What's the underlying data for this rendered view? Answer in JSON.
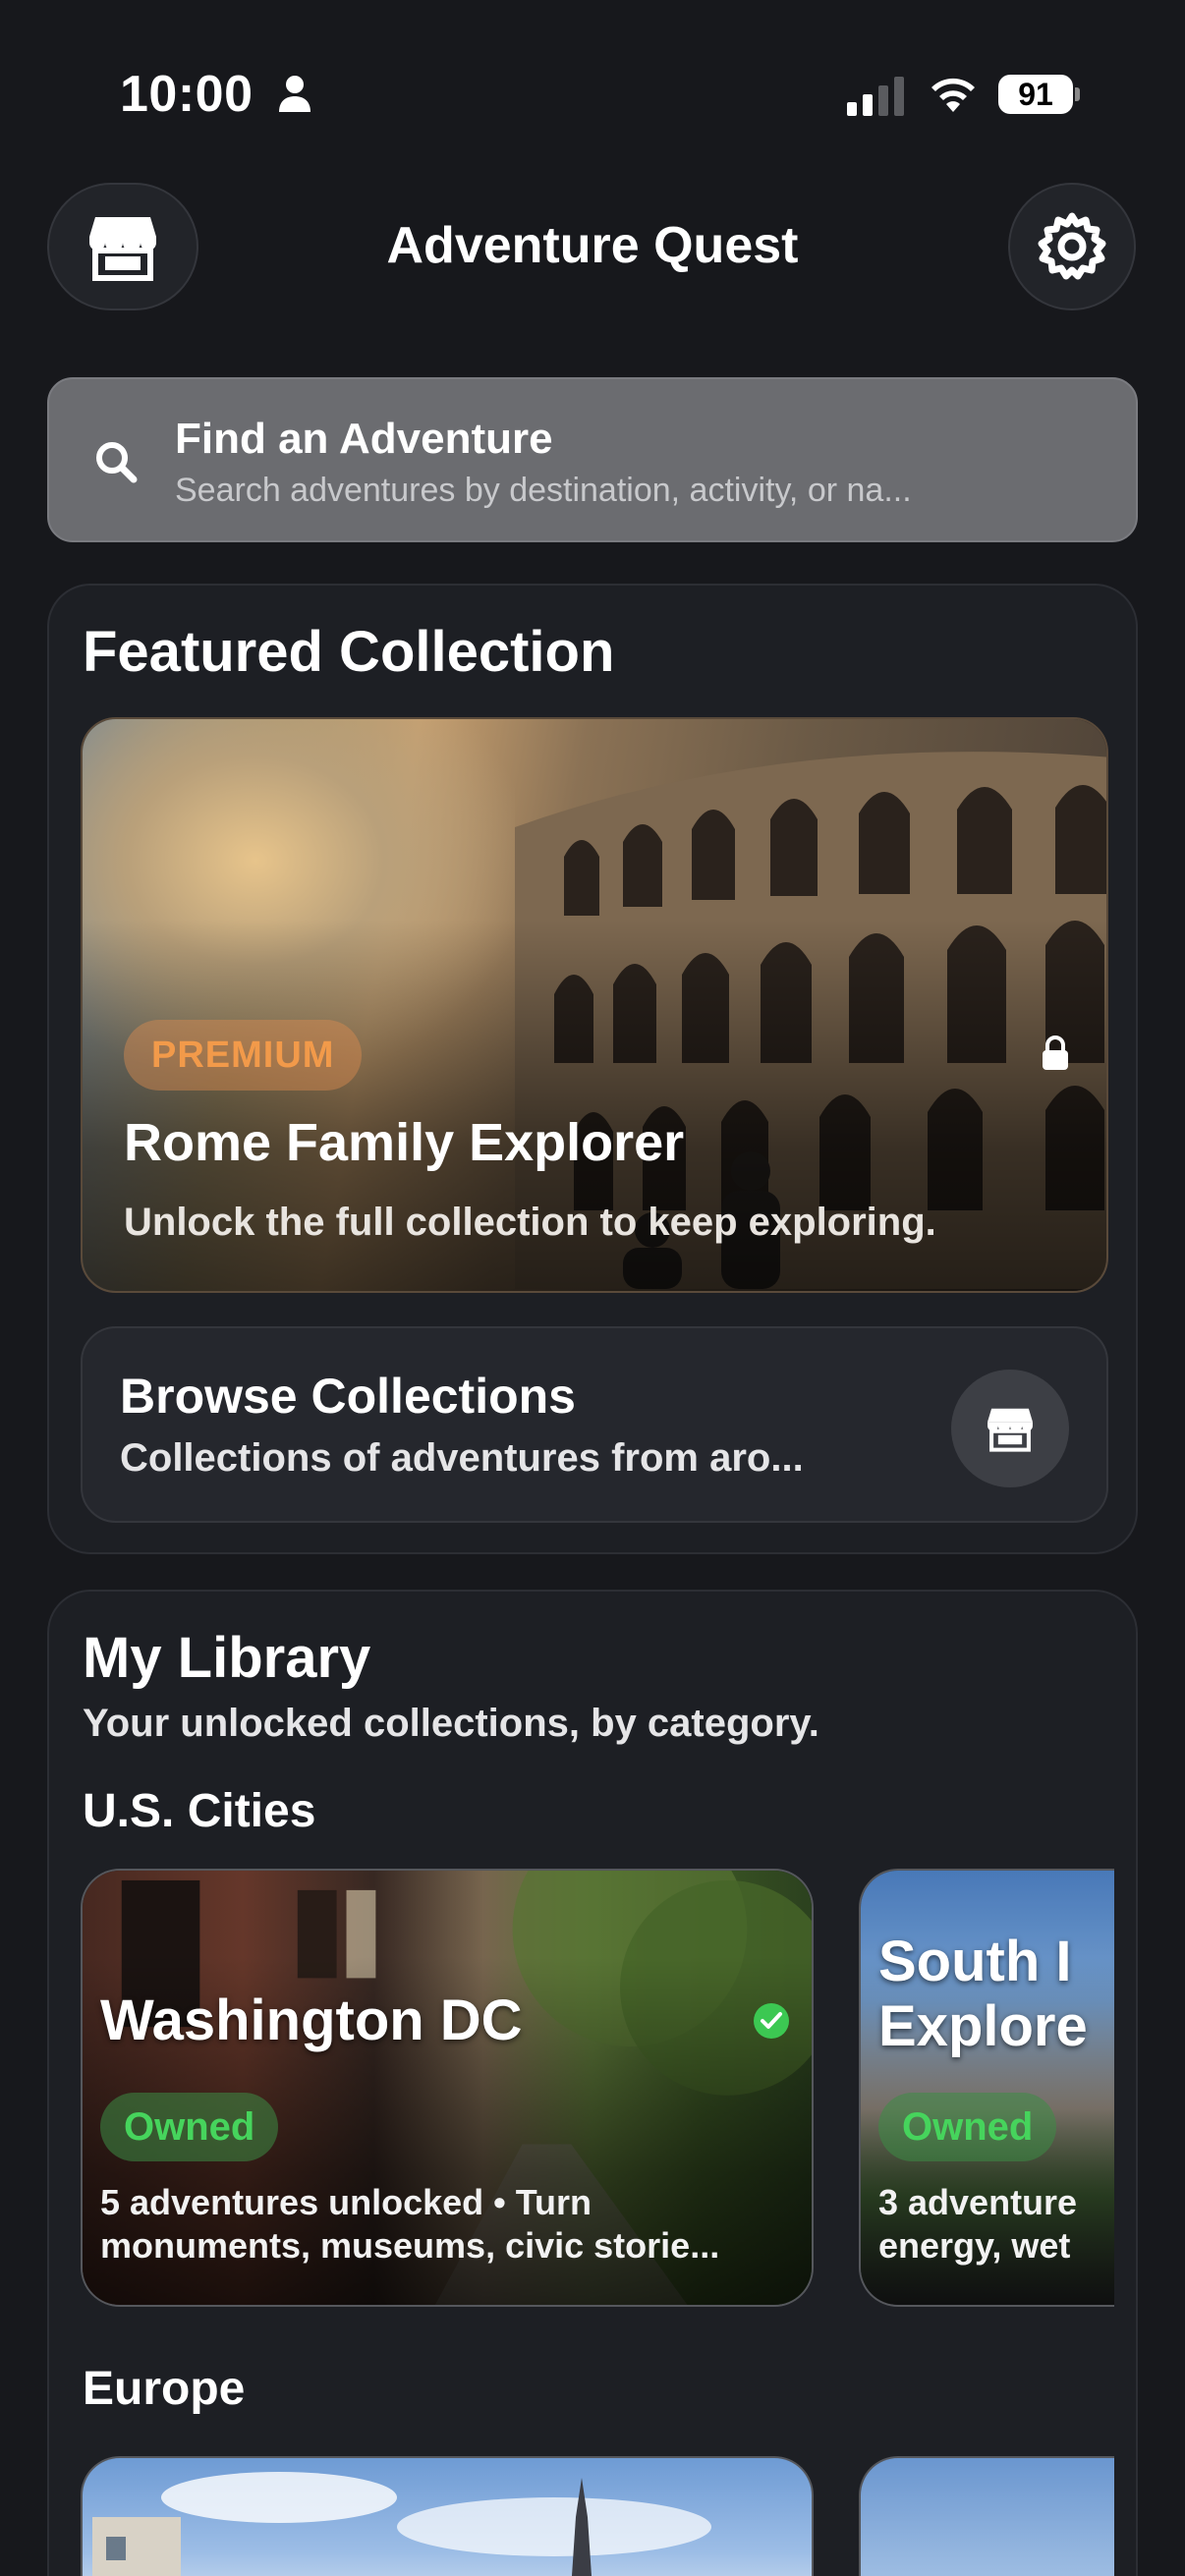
{
  "status_bar": {
    "time": "10:00",
    "battery": "91"
  },
  "header": {
    "title": "Adventure Quest",
    "left_icon": "store-icon",
    "right_icon": "gear-icon"
  },
  "search": {
    "title": "Find an Adventure",
    "placeholder": "Search adventures by destination, activity, or na..."
  },
  "featured": {
    "title": "Featured Collection",
    "hero": {
      "badge": "PREMIUM",
      "title": "Rome Family Explorer",
      "subtitle": "Unlock the full collection to keep exploring."
    },
    "browse": {
      "title": "Browse Collections",
      "subtitle": "Collections of adventures from aro..."
    }
  },
  "library": {
    "title": "My Library",
    "subtitle": "Your unlocked collections, by category.",
    "sections": [
      {
        "label": "U.S. Cities",
        "tiles": [
          {
            "title": "Washington DC",
            "badge": "Owned",
            "desc_line1": "5 adventures unlocked • Turn",
            "desc_line2": "monuments, museums, civic storie..."
          },
          {
            "title_line1": "South I",
            "title_line2": "Explore",
            "badge": "Owned",
            "desc_line1": "3 adventure",
            "desc_line2": "energy, wet"
          }
        ]
      },
      {
        "label": "Europe"
      }
    ]
  },
  "colors": {
    "background": "#17181c",
    "panel": "#1d1f24",
    "premium": "#f29a4a",
    "owned": "#46d45c"
  }
}
